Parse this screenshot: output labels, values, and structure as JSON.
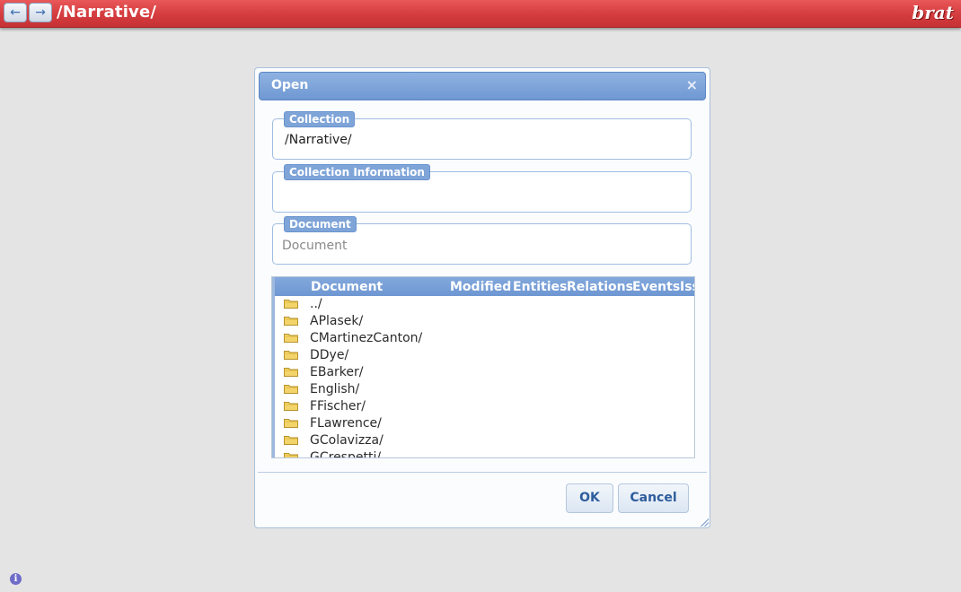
{
  "header": {
    "back_icon": "arrow-left-icon",
    "forward_icon": "arrow-right-icon",
    "path": "/Narrative/",
    "logo": "brat"
  },
  "dialog": {
    "title": "Open",
    "close_label": "×",
    "collection": {
      "legend": "Collection",
      "value": "/Narrative/"
    },
    "collection_info": {
      "legend": "Collection Information",
      "value": ""
    },
    "document": {
      "legend": "Document",
      "placeholder": "Document",
      "value": ""
    },
    "table": {
      "columns": [
        "Document",
        "Modified",
        "Entities",
        "Relations",
        "Events",
        "Iss"
      ],
      "rows": [
        {
          "name": "../",
          "icon": "folder-icon"
        },
        {
          "name": "APlasek/",
          "icon": "folder-icon"
        },
        {
          "name": "CMartinezCanton/",
          "icon": "folder-icon"
        },
        {
          "name": "DDye/",
          "icon": "folder-icon"
        },
        {
          "name": "EBarker/",
          "icon": "folder-icon"
        },
        {
          "name": "English/",
          "icon": "folder-icon"
        },
        {
          "name": "FFischer/",
          "icon": "folder-icon"
        },
        {
          "name": "FLawrence/",
          "icon": "folder-icon"
        },
        {
          "name": "GColavizza/",
          "icon": "folder-icon"
        },
        {
          "name": "GCrespetti/",
          "icon": "folder-icon"
        }
      ]
    },
    "buttons": {
      "ok": "OK",
      "cancel": "Cancel"
    }
  },
  "footer": {
    "info_icon": "info-icon",
    "info_glyph": "i"
  }
}
